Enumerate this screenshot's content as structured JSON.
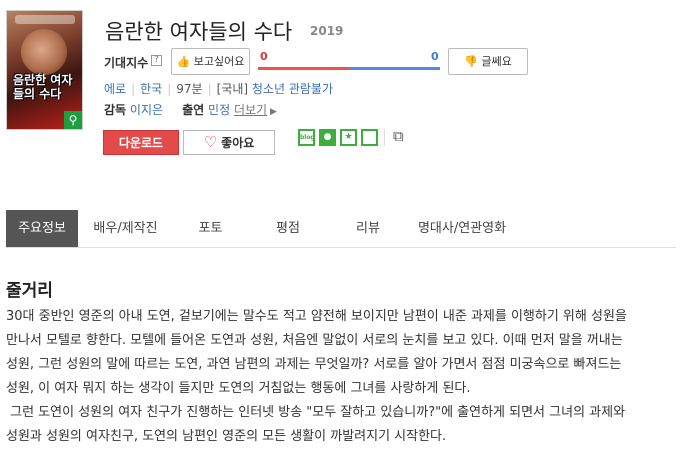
{
  "poster": {
    "title_text": "음란한 여자들의 수다",
    "search_icon": "search-icon"
  },
  "movie": {
    "title": "음란한 여자들의 수다",
    "year": "2019"
  },
  "expectation": {
    "label": "기대지수",
    "help": "?",
    "want_label": "보고싶어요",
    "want_count": "0",
    "meh_label": "글쎄요",
    "meh_count": "0",
    "want_color": "#f0504e",
    "meh_color": "#4f8ae3"
  },
  "info": {
    "genre": "에로",
    "country": "한국",
    "runtime": "97분",
    "rating_prefix": "[국내]",
    "rating": "청소년 관람불가"
  },
  "people": {
    "director_label": "감독",
    "director": "이지은",
    "cast_label": "출연",
    "cast": "민정",
    "more": "더보기"
  },
  "actions": {
    "download": "다운로드",
    "like": "좋아요",
    "accent": "#e34b4b"
  },
  "sns": {
    "blog": "blog",
    "share_icon": "share-icon"
  },
  "tabs": [
    {
      "label": "주요정보"
    },
    {
      "label": "배우/제작진"
    },
    {
      "label": "포토"
    },
    {
      "label": "평점"
    },
    {
      "label": "리뷰"
    },
    {
      "label": "명대사/연관영화"
    }
  ],
  "synopsis": {
    "title": "줄거리",
    "lines": [
      "30대 중반인 영준의 아내 도연, 겉보기에는 말수도 적고 얌전해 보이지만 남편이 내준 과제를 이행하기 위해 성원을",
      "만나서 모텔로 향한다. 모텔에 들어온 도연과 성원, 처음엔 말없이 서로의 눈치를 보고 있다. 이때 먼저 말을 꺼내는",
      "성원, 그런 성원의 말에 따르는 도연, 과연 남편의 과제는 무엇일까? 서로를 알아 가면서 점점 미궁속으로 빠져드는",
      "성원, 이 여자 뭐지 하는 생각이 들지만 도연의 거침없는 행동에 그녀를 사랑하게 된다.",
      " 그런 도연이 성원의 여자 친구가 진행하는 인터넷 방송 \"모두 잘하고 있습니까?\"에 출연하게 되면서 그녀의 과제와",
      "성원과 성원의 여자친구, 도연의 남편인 영준의 모든 생활이 까발려지기 시작한다."
    ]
  }
}
